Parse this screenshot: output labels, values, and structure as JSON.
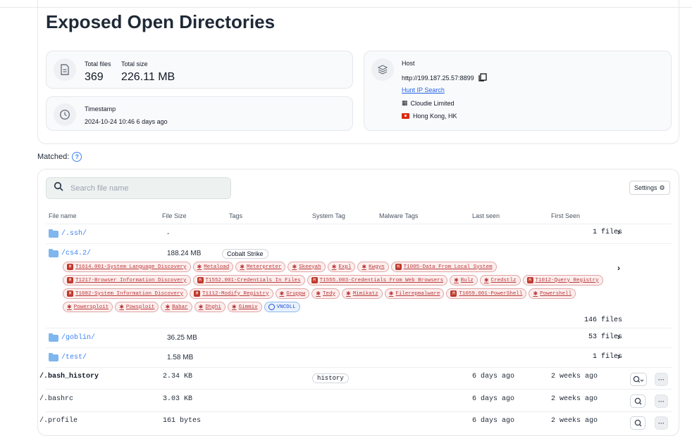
{
  "title": "Exposed Open Directories",
  "stats": {
    "total_files_label": "Total files",
    "total_size_label": "Total size",
    "total_files": "369",
    "total_size": "226.11 MB",
    "timestamp_label": "Timestamp",
    "timestamp_value": "2024-10-24 10:46 6 days ago"
  },
  "host": {
    "label": "Host",
    "url": "http://199.187.25.57:8899",
    "hunt_link": "Hunt IP Search",
    "org": "Cloudie Limited",
    "location": "Hong Kong, HK"
  },
  "matched_label": "Matched:",
  "search": {
    "placeholder": "Search file name"
  },
  "settings_label": "Settings",
  "columns": {
    "file_name": "File name",
    "file_size": "File Size",
    "tags": "Tags",
    "system_tag": "System Tag",
    "malware_tags": "Malware Tags",
    "last_seen": "Last seen",
    "first_seen": "First Seen"
  },
  "dirs": [
    {
      "name": "/.ssh/",
      "size": "-",
      "files": "1 files"
    },
    {
      "name": "/cs4.2/",
      "size": "188.24 MB",
      "tag": "Cobalt Strike",
      "files": "146 files"
    },
    {
      "name": "/goblin/",
      "size": "36.25 MB",
      "files": "53 files"
    },
    {
      "name": "/test/",
      "size": "1.58 MB",
      "files": "1 files"
    }
  ],
  "cs_tags": [
    {
      "kind": "m",
      "text": "T1614.001-System Language Discovery"
    },
    {
      "kind": "b",
      "text": "Metaload"
    },
    {
      "kind": "b",
      "text": "Meterpreter"
    },
    {
      "kind": "b",
      "text": "Skeeyah"
    },
    {
      "kind": "b",
      "text": "Expl"
    },
    {
      "kind": "b",
      "text": "Kwgyn"
    },
    {
      "kind": "m",
      "text": "T1005-Data From Local System"
    },
    {
      "kind": "m",
      "text": "T1217-Browser Information Discovery"
    },
    {
      "kind": "m",
      "text": "T1552.001-Credentials In Files"
    },
    {
      "kind": "m",
      "text": "T1555.003-Credentials From Web Browsers"
    },
    {
      "kind": "b",
      "text": "Bulz"
    },
    {
      "kind": "b",
      "text": "Credstlz"
    },
    {
      "kind": "m",
      "text": "T1012-Query Registry"
    },
    {
      "kind": "m",
      "text": "T1082-System Information Discovery"
    },
    {
      "kind": "m",
      "text": "T1112-Modify Registry"
    },
    {
      "kind": "b",
      "text": "Gruppw"
    },
    {
      "kind": "b",
      "text": "Tedy"
    },
    {
      "kind": "b",
      "text": "Mimikatz"
    },
    {
      "kind": "b",
      "text": "Filerepmalware"
    },
    {
      "kind": "m",
      "text": "T1059.001-PowerShell"
    },
    {
      "kind": "b",
      "text": "Powershell"
    },
    {
      "kind": "b",
      "text": "Powersploit"
    },
    {
      "kind": "b",
      "text": "Powsploit"
    },
    {
      "kind": "b",
      "text": "Babar"
    },
    {
      "kind": "b",
      "text": "Dhghi"
    },
    {
      "kind": "b",
      "text": "Gimmiv"
    },
    {
      "kind": "g",
      "text": "VNCDLL"
    }
  ],
  "files": [
    {
      "name": "/.bash_history",
      "size": "2.34 KB",
      "system_tag": "history",
      "last_seen": "6 days ago",
      "first_seen": "2 weeks ago"
    },
    {
      "name": "/.bashrc",
      "size": "3.03 KB",
      "last_seen": "6 days ago",
      "first_seen": "2 weeks ago"
    },
    {
      "name": "/.profile",
      "size": "161 bytes",
      "last_seen": "6 days ago",
      "first_seen": "2 weeks ago"
    }
  ],
  "icons": {
    "file": "file-icon",
    "clock": "clock-icon",
    "host": "stack-icon",
    "copy": "copy-icon",
    "org": "building-icon",
    "flag": "flag-hk-icon",
    "search": "search-icon",
    "gear": "gear-icon",
    "chevron": "chevron-right-icon",
    "magnify": "magnify-icon",
    "more": "more-icon"
  },
  "colors": {
    "link": "#3b82f6",
    "tag_red": "#b93838",
    "tag_blue": "#1d4ed8"
  }
}
